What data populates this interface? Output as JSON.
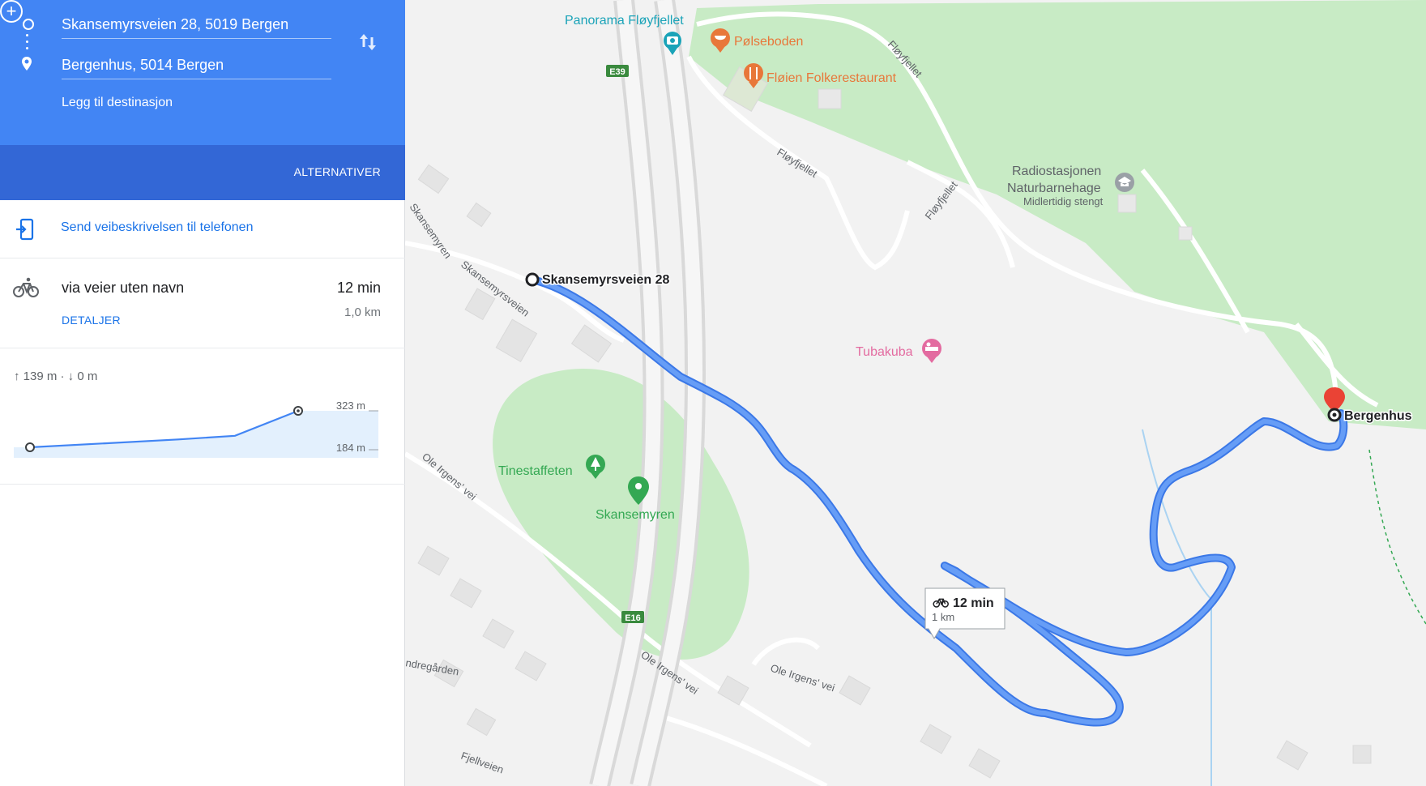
{
  "directions": {
    "origin": "Skansemyrsveien 28, 5019 Bergen",
    "destination": "Bergenhus, 5014 Bergen",
    "add_destination_label": "Legg til destinasjon",
    "alternatives_label": "ALTERNATIVER"
  },
  "send_to_phone": {
    "label": "Send veibeskrivelsen til telefonen"
  },
  "route_option": {
    "mode": "bicycle",
    "via": "via veier uten navn",
    "duration": "12 min",
    "distance": "1,0 km",
    "details_label": "DETALJER"
  },
  "elevation": {
    "summary": "↑ 139 m · ↓ 0 m",
    "max_label": "323 m",
    "min_label": "184 m",
    "profile_m": [
      184,
      199,
      214,
      228,
      323
    ]
  },
  "map": {
    "labels": {
      "panorama": "Panorama Fløyfjellet",
      "polseboden": "Pølseboden",
      "floien": "Fløien Folkerestaurant",
      "floyfjellet_1": "Fløyfjellet",
      "floyfjellet_2": "Fløyfjellet",
      "floyfjellet_3": "Fløyfjellet",
      "radio_name_1": "Radiostasjonen",
      "radio_name_2": "Naturbarnehage",
      "radio_status": "Midlertidig stengt",
      "tubakuba": "Tubakuba",
      "tinestaffeten": "Tinestaffeten",
      "skansemyren": "Skansemyren",
      "skansemyren_road": "Skansemyren",
      "skansemyrsveien_road": "Skansemyrsveien",
      "ole_irgens_1": "Ole Irgens' vei",
      "ole_irgens_2": "Ole Irgens' vei",
      "ole_irgens_3": "Ole Irgens' vei",
      "fjellveien": "Fjellveien",
      "nedregarden": "ndregården",
      "e39": "E39",
      "e16": "E16",
      "start_label": "Skansemyrsveien 28",
      "end_label": "Bergenhus",
      "callout_time": "12 min",
      "callout_distance": "1 km"
    },
    "colors": {
      "route": "#4285f4",
      "park": "#c8ebc5",
      "land": "#f2f2f2",
      "poi_orange": "#e8773a",
      "poi_teal": "#1aa3b8",
      "poi_green": "#34a853",
      "poi_pink": "#e36ba0",
      "marker_red": "#ea4335"
    }
  }
}
